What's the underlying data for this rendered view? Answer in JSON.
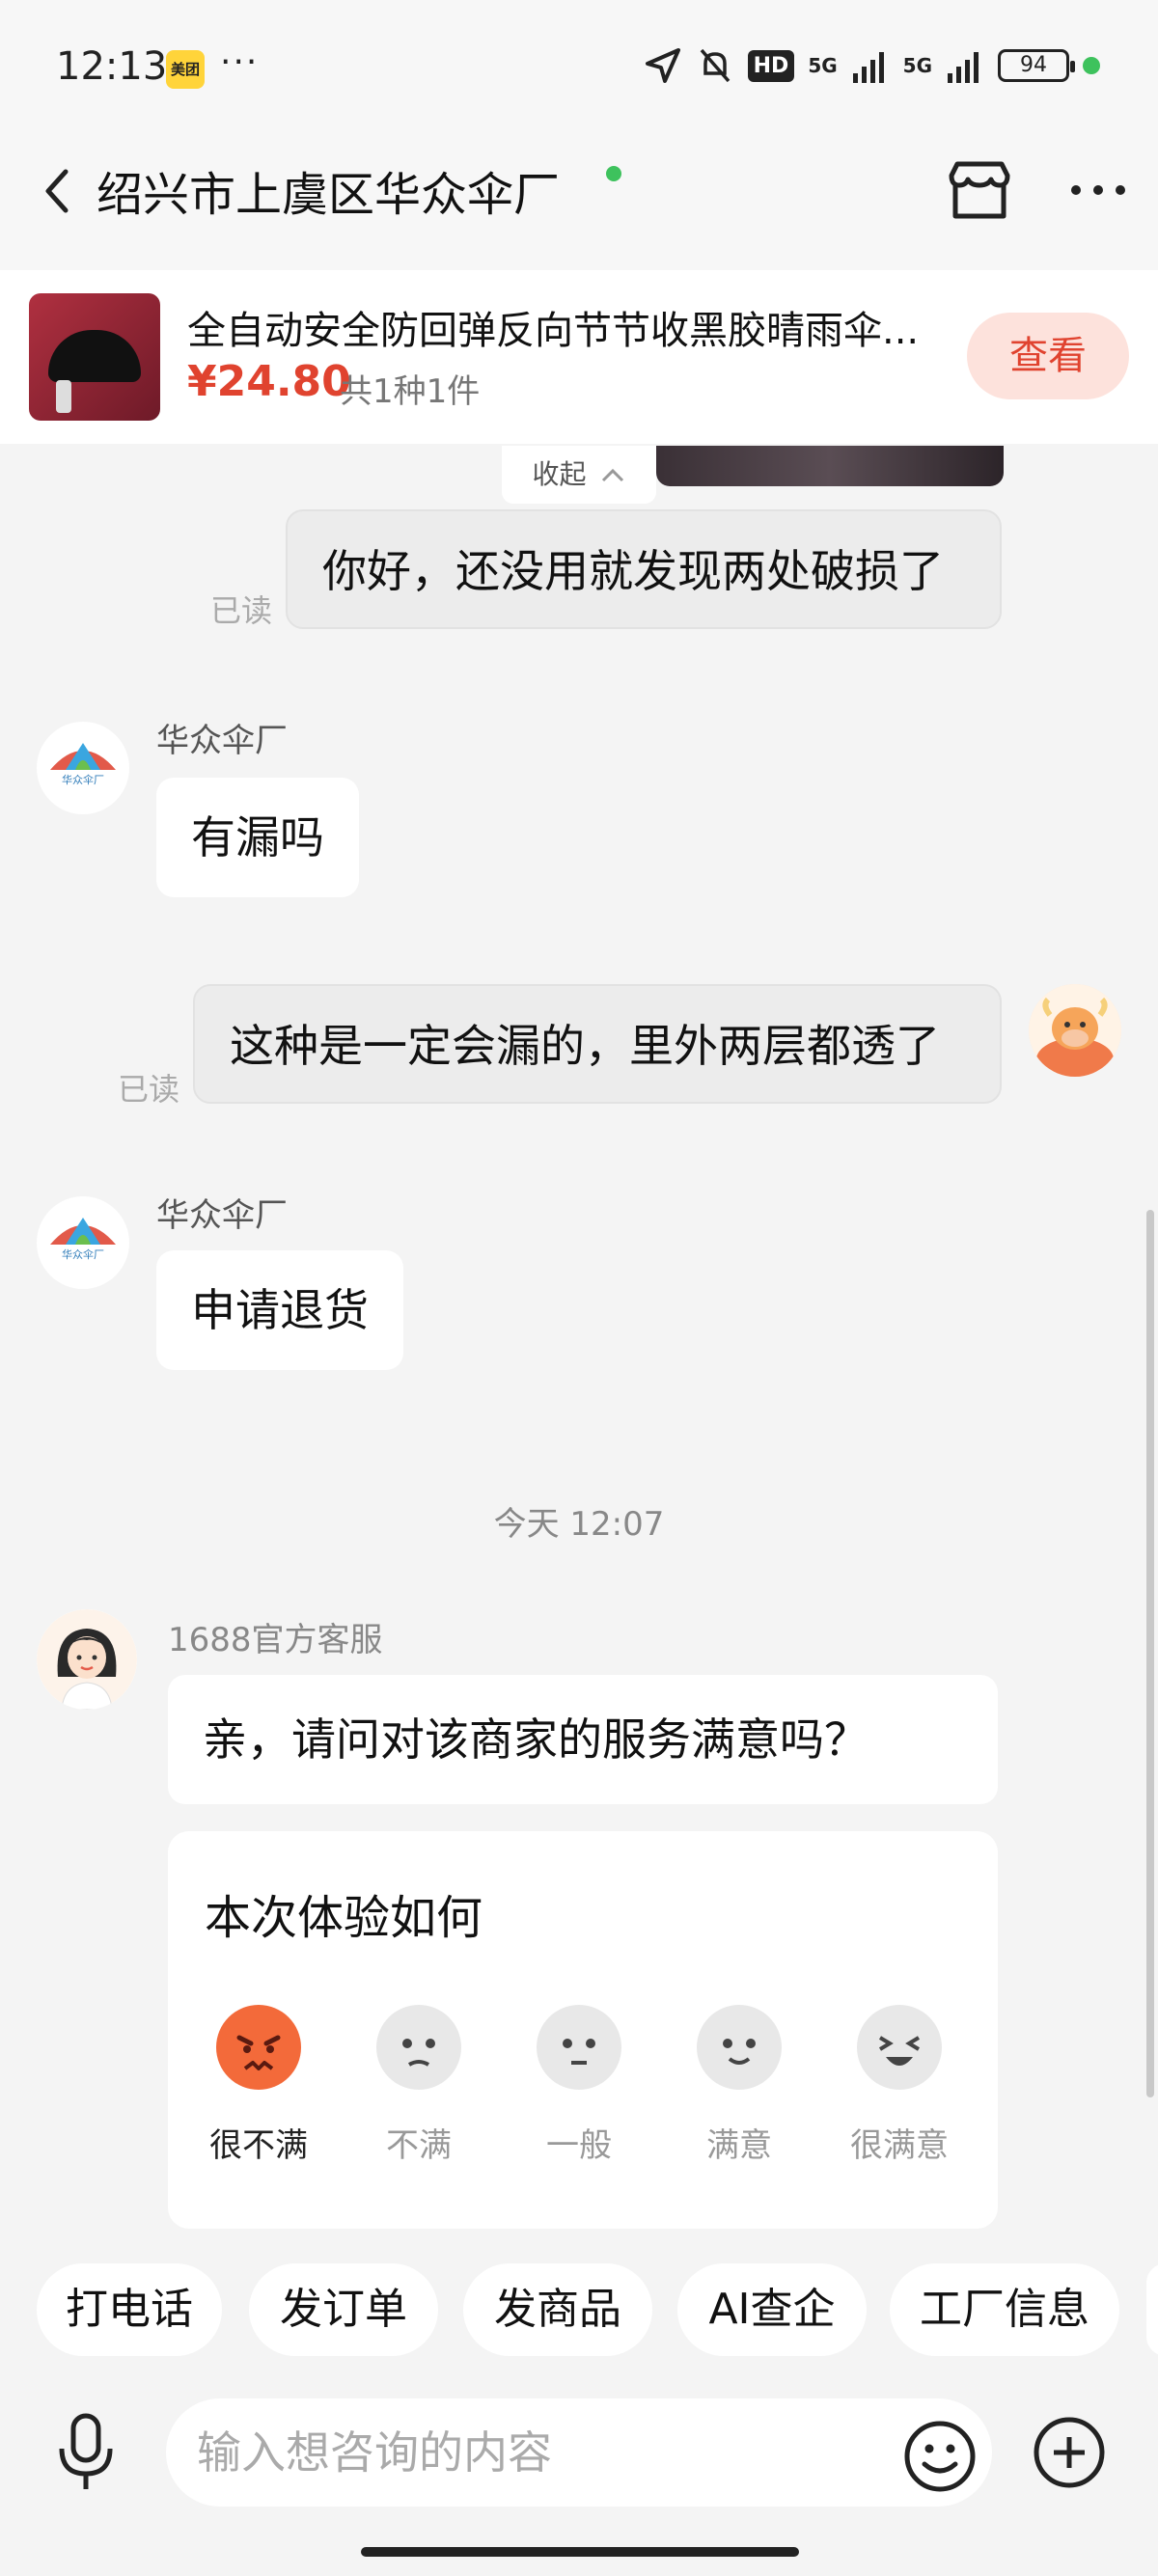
{
  "status_bar": {
    "time": "12:13",
    "app_badge": "美团",
    "more_dots": "···",
    "hd_label": "HD",
    "net1": "5G",
    "net2": "5G",
    "battery": "94"
  },
  "header": {
    "title": "绍兴市上虞区华众伞厂"
  },
  "product": {
    "title": "全自动安全防回弹反向节节收黑胶晴雨伞...",
    "price": "¥24.80",
    "count": "共1种1件",
    "view_label": "查看"
  },
  "chat": {
    "collapse_label": "收起",
    "messages": [
      {
        "side": "out",
        "text": "你好，还没用就发现两处破损了",
        "status": "已读"
      },
      {
        "side": "in",
        "sender": "华众伞厂",
        "text": "有漏吗"
      },
      {
        "side": "out",
        "text": "这种是一定会漏的，里外两层都透了",
        "status": "已读"
      },
      {
        "side": "in",
        "sender": "华众伞厂",
        "text": "申请退货"
      }
    ],
    "timestamp": "今天  12:07",
    "service": {
      "sender": "1688官方客服",
      "text": "亲，请问对该商家的服务满意吗？"
    },
    "survey": {
      "title": "本次体验如何",
      "options": [
        "很不满",
        "不满",
        "一般",
        "满意",
        "很满意"
      ],
      "selected": "很不满"
    }
  },
  "quick_actions": [
    "打电话",
    "发订单",
    "发商品",
    "AI查企",
    "工厂信息"
  ],
  "input": {
    "placeholder": "输入想咨询的内容"
  },
  "colors": {
    "accent": "#e0432f",
    "online": "#3ec25d"
  }
}
